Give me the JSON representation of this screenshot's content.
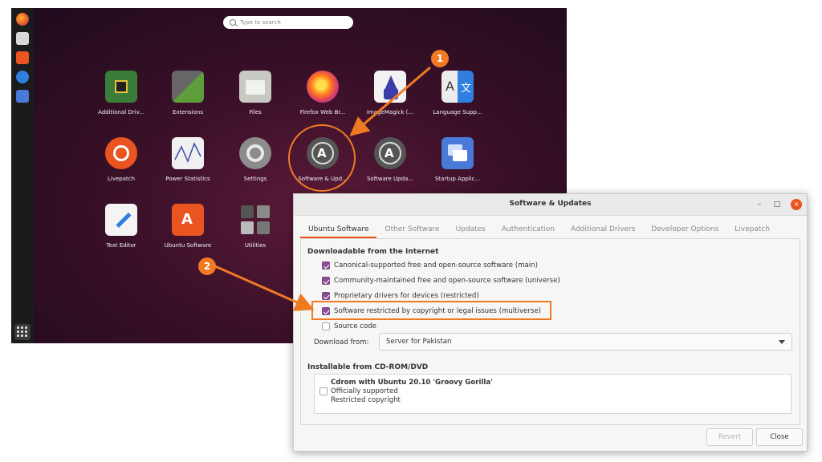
{
  "search": {
    "placeholder": "Type to search"
  },
  "dock": {
    "icons": [
      "firefox-icon",
      "files-icon",
      "ubuntu-software-icon",
      "help-icon",
      "screenshot-icon"
    ]
  },
  "apps": [
    {
      "label": "Additional Driv...",
      "icon": "chip-icon"
    },
    {
      "label": "Extensions",
      "icon": "puzzle-icon"
    },
    {
      "label": "Files",
      "icon": "folder-icon"
    },
    {
      "label": "Firefox Web Br...",
      "icon": "firefox-icon"
    },
    {
      "label": "ImageMagick (...",
      "icon": "wizard-icon"
    },
    {
      "label": "Language Supp...",
      "icon": "translate-icon"
    },
    {
      "label": "Livepatch",
      "icon": "livepatch-icon"
    },
    {
      "label": "Power Statistics",
      "icon": "graph-icon"
    },
    {
      "label": "Settings",
      "icon": "gear-icon"
    },
    {
      "label": "Software & Upd...",
      "icon": "software-updates-icon"
    },
    {
      "label": "Software Upda...",
      "icon": "software-updater-icon"
    },
    {
      "label": "Startup Applic...",
      "icon": "startup-icon"
    },
    {
      "label": "Text Editor",
      "icon": "text-editor-icon"
    },
    {
      "label": "Ubuntu Software",
      "icon": "ubuntu-software-icon"
    },
    {
      "label": "Utilities",
      "icon": "utilities-folder-icon"
    }
  ],
  "window": {
    "title": "Software & Updates",
    "controls": {
      "minimize": "–",
      "maximize": "□",
      "close": "×"
    },
    "tabs": [
      "Ubuntu Software",
      "Other Software",
      "Updates",
      "Authentication",
      "Additional Drivers",
      "Developer Options",
      "Livepatch"
    ],
    "active_tab": "Ubuntu Software",
    "downloadable_heading": "Downloadable from the Internet",
    "sources": [
      {
        "label": "Canonical-supported free and open-source software (main)",
        "checked": true
      },
      {
        "label": "Community-maintained free and open-source software (universe)",
        "checked": true
      },
      {
        "label": "Proprietary drivers for devices (restricted)",
        "checked": true
      },
      {
        "label": "Software restricted by copyright or legal issues (multiverse)",
        "checked": true
      },
      {
        "label": "Source code",
        "checked": false
      }
    ],
    "download_from_label": "Download from:",
    "download_from_value": "Server for Pakistan",
    "cdrom_heading": "Installable from CD-ROM/DVD",
    "cdrom": {
      "title": "Cdrom with Ubuntu 20.10 'Groovy Gorilla'",
      "line2": "Officially supported",
      "line3": "Restricted copyright",
      "checked": false
    },
    "revert_label": "Revert",
    "close_label": "Close"
  },
  "annotations": {
    "badge1": "1",
    "badge2": "2",
    "color": "#f07a23"
  }
}
